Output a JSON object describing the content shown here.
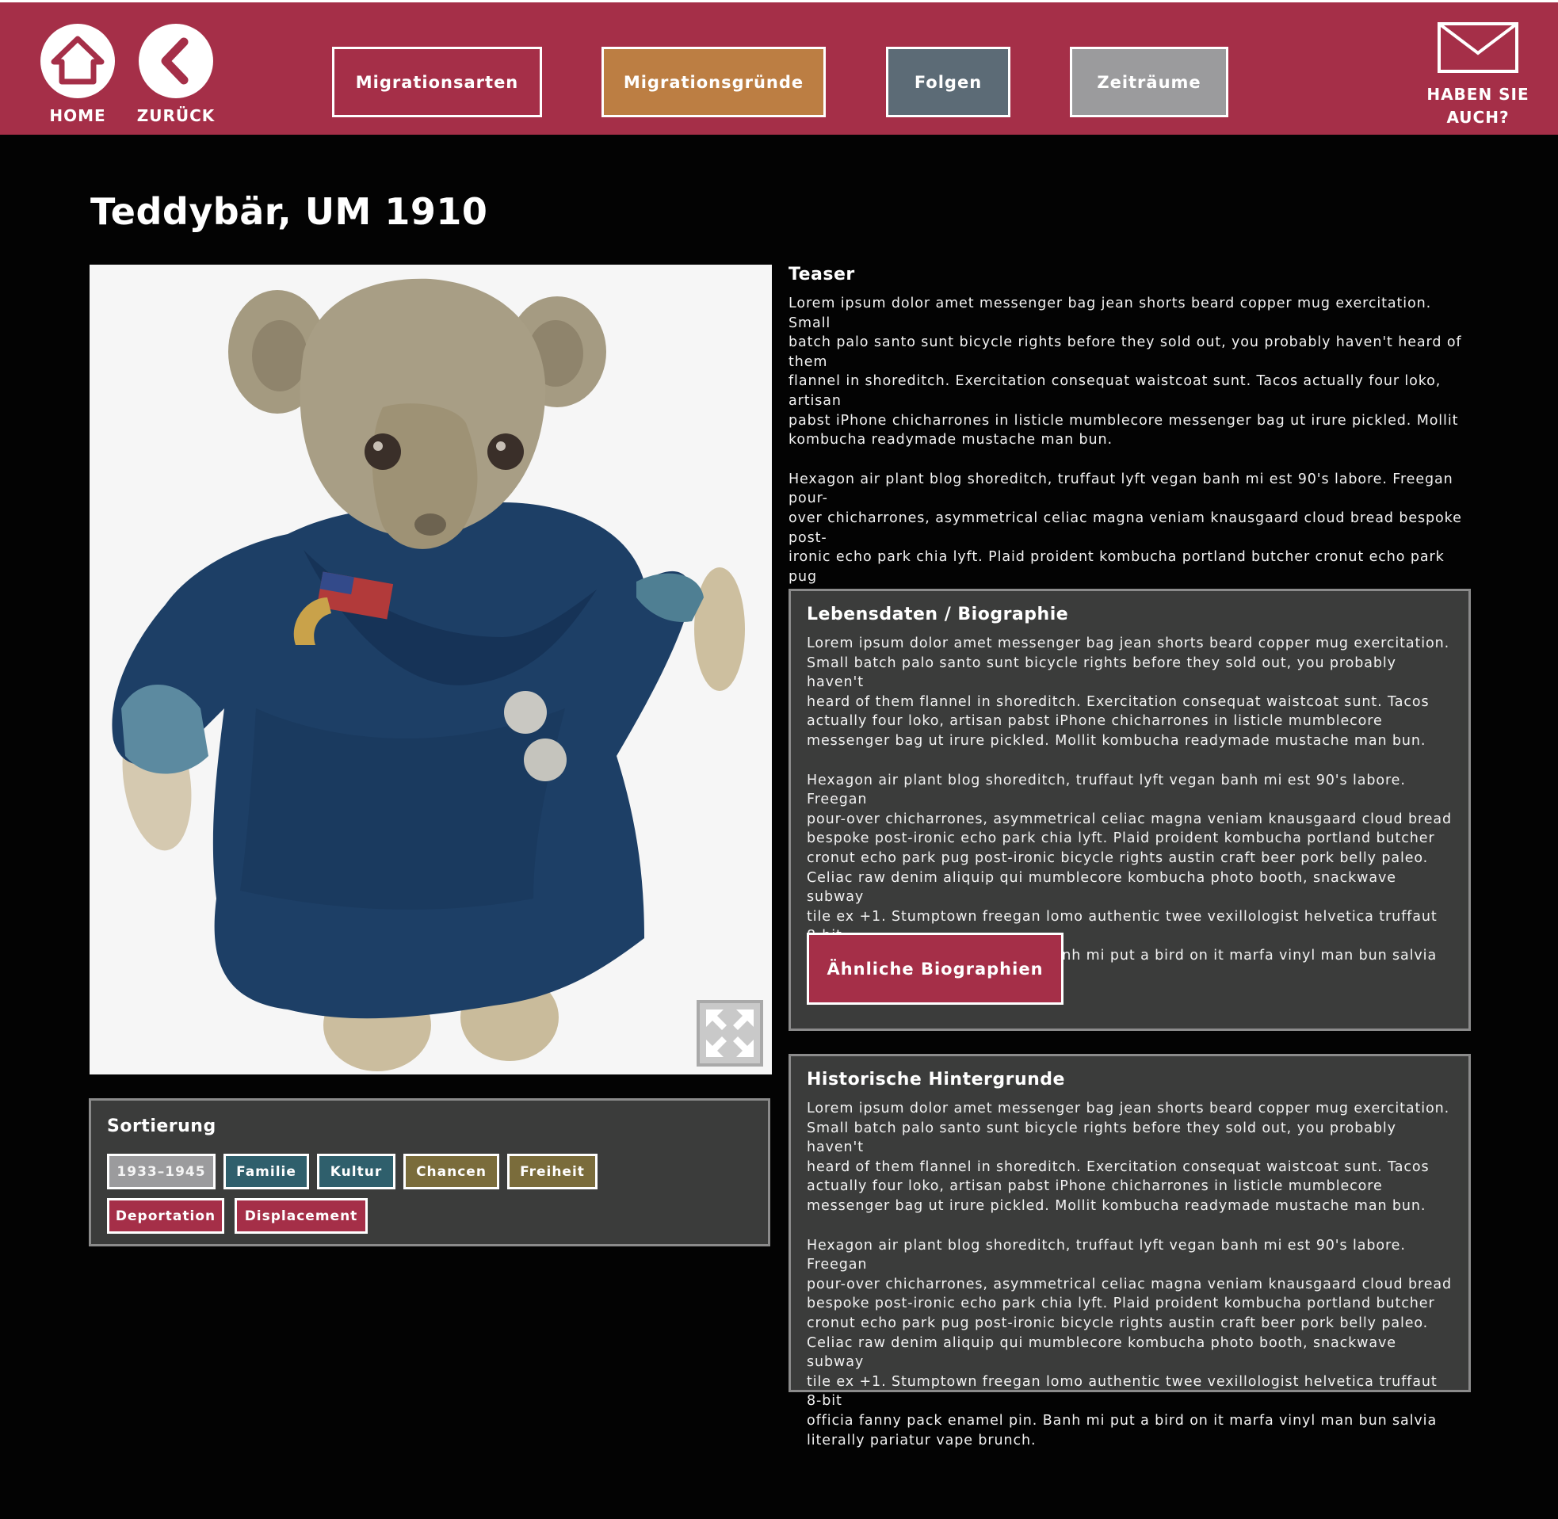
{
  "header": {
    "home_label": "HOME",
    "back_label": "ZURÜCK",
    "nav": [
      {
        "label": "Migrationsarten",
        "color": "#a52f48"
      },
      {
        "label": "Migrationsgründe",
        "color": "#bc7e43"
      },
      {
        "label": "Folgen",
        "color": "#5c6b76"
      },
      {
        "label": "Zeiträume",
        "color": "#9b9b9d"
      }
    ],
    "mail_label_line1": "HABEN SIE",
    "mail_label_line2": "AUCH?",
    "background_color": "#a52f48"
  },
  "page": {
    "title": "Teddybär, UM 1910"
  },
  "object_image": {
    "subject": "teddy-bear-blue-velvet-coat",
    "expand_icon": "expand-arrows-icon"
  },
  "sorting": {
    "title": "Sortierung",
    "tags": [
      {
        "label": "1933–1945",
        "color": "#9b9b9d"
      },
      {
        "label": "Familie",
        "color": "#2f5f6c"
      },
      {
        "label": "Kultur",
        "color": "#2f5f6c"
      },
      {
        "label": "Chancen",
        "color": "#7a6c3b"
      },
      {
        "label": "Freiheit",
        "color": "#7a6c3b"
      },
      {
        "label": "Deportation",
        "color": "#a52f48"
      },
      {
        "label": "Displacement",
        "color": "#a52f48"
      }
    ]
  },
  "teaser": {
    "title": "Teaser",
    "paragraphs": [
      "Lorem ipsum dolor amet messenger bag jean shorts beard copper mug exercitation. Small\nbatch palo santo sunt bicycle rights before they sold out, you probably haven't heard of them\nflannel in shoreditch. Exercitation consequat waistcoat sunt. Tacos actually four loko, artisan\npabst iPhone chicharrones in listicle mumblecore messenger bag ut irure pickled. Mollit\nkombucha readymade mustache man bun.",
      "Hexagon air plant blog shoreditch, truffaut lyft vegan banh mi est 90's labore. Freegan pour-\nover chicharrones, asymmetrical celiac magna veniam knausgaard cloud bread bespoke post-\nironic echo park chia lyft. Plaid proident kombucha portland butcher cronut echo park pug\npost-ironic bicycle rights austin craft beer pork belly paleo. Celiac raw denim aliquip qui\nmumblecore kombucha photo booth, snackwave subway tile ex +1. Stumptown freegan lomo\nauthentic twee vexillologist helvetica truffaut 8-bit officia fanny pack enamel pin. Banh mi put\na bird on it marfa vinyl man bun salvia literally pariatur vape brunch."
    ]
  },
  "biography": {
    "title": "Lebensdaten / Biographie",
    "paragraphs": [
      "Lorem ipsum dolor amet messenger bag jean shorts beard copper mug exercitation.\nSmall batch palo santo sunt bicycle rights before they sold out, you probably haven't\nheard of them flannel in shoreditch. Exercitation consequat waistcoat sunt. Tacos\nactually four loko, artisan pabst iPhone chicharrones in listicle mumblecore\nmessenger bag ut irure pickled. Mollit kombucha readymade mustache man bun.",
      "Hexagon air plant blog shoreditch, truffaut lyft vegan banh mi est 90's labore. Freegan\npour-over chicharrones, asymmetrical celiac magna veniam knausgaard cloud bread\nbespoke post-ironic echo park chia lyft. Plaid proident kombucha portland butcher\ncronut echo park pug post-ironic bicycle rights austin craft beer pork belly paleo.\nCeliac raw denim aliquip qui mumblecore kombucha photo booth, snackwave subway\ntile ex +1. Stumptown freegan lomo authentic twee vexillologist helvetica truffaut 8-bit\nofficia fanny pack enamel pin. Banh mi put a bird on it marfa vinyl man bun salvia\nliterally pariatur vape brunch."
    ],
    "button_label": "Ähnliche Biographien"
  },
  "history": {
    "title": "Historische Hintergrunde",
    "paragraphs": [
      "Lorem ipsum dolor amet messenger bag jean shorts beard copper mug exercitation.\nSmall batch palo santo sunt bicycle rights before they sold out, you probably haven't\nheard of them flannel in shoreditch. Exercitation consequat waistcoat sunt. Tacos\nactually four loko, artisan pabst iPhone chicharrones in listicle mumblecore\nmessenger bag ut irure pickled. Mollit kombucha readymade mustache man bun.",
      "Hexagon air plant blog shoreditch, truffaut lyft vegan banh mi est 90's labore. Freegan\npour-over chicharrones, asymmetrical celiac magna veniam knausgaard cloud bread\nbespoke post-ironic echo park chia lyft. Plaid proident kombucha portland butcher\ncronut echo park pug post-ironic bicycle rights austin craft beer pork belly paleo.\nCeliac raw denim aliquip qui mumblecore kombucha photo booth, snackwave subway\ntile ex +1. Stumptown freegan lomo authentic twee vexillologist helvetica truffaut 8-bit\nofficia fanny pack enamel pin. Banh mi put a bird on it marfa vinyl man bun salvia\nliterally pariatur vape brunch."
    ]
  }
}
